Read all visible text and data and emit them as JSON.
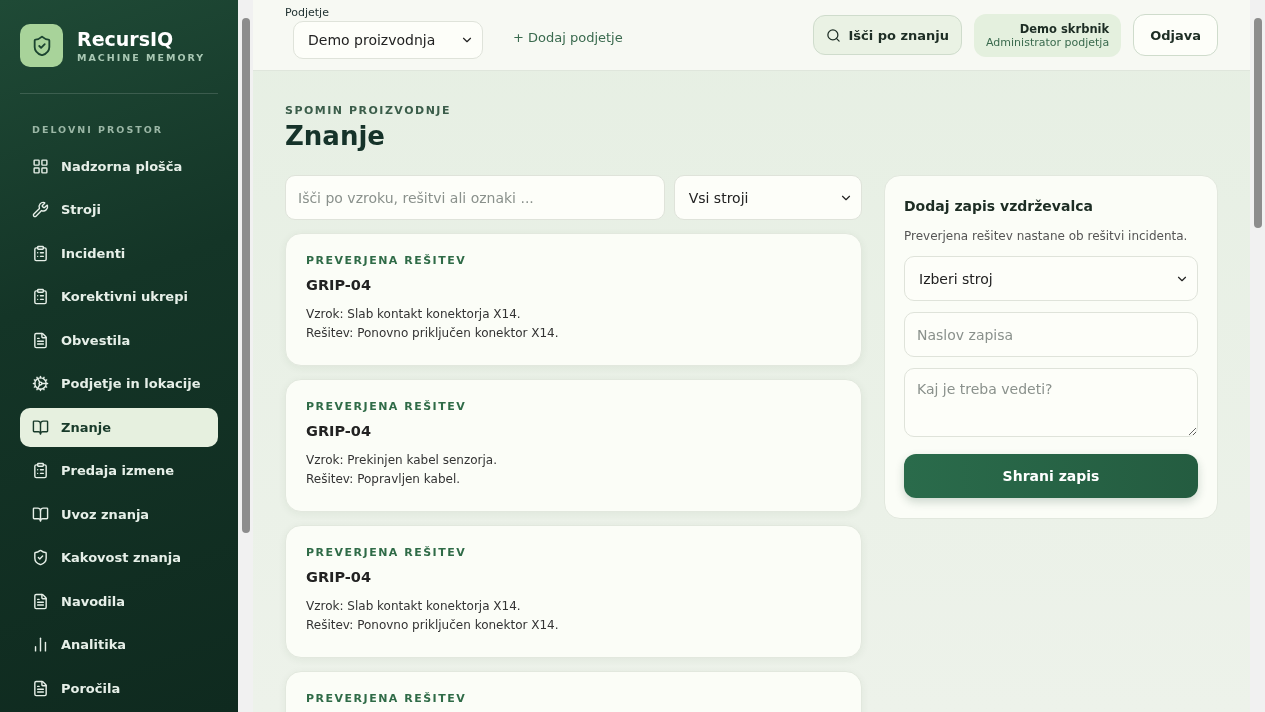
{
  "brand": {
    "name": "RecursIQ",
    "tagline": "MACHINE MEMORY"
  },
  "sidebar": {
    "section": "DELOVNI PROSTOR",
    "items": [
      {
        "label": "Nadzorna plošča",
        "selected": false
      },
      {
        "label": "Stroji",
        "selected": false
      },
      {
        "label": "Incidenti",
        "selected": false
      },
      {
        "label": "Korektivni ukrepi",
        "selected": false
      },
      {
        "label": "Obvestila",
        "selected": false
      },
      {
        "label": "Podjetje in lokacije",
        "selected": false
      },
      {
        "label": "Znanje",
        "selected": true
      },
      {
        "label": "Predaja izmene",
        "selected": false
      },
      {
        "label": "Uvoz znanja",
        "selected": false
      },
      {
        "label": "Kakovost znanja",
        "selected": false
      },
      {
        "label": "Navodila",
        "selected": false
      },
      {
        "label": "Analitika",
        "selected": false
      },
      {
        "label": "Poročila",
        "selected": false
      }
    ]
  },
  "topbar": {
    "company_label": "Podjetje",
    "company_value": "Demo proizvodnja",
    "add_company": "+ Dodaj podjetje",
    "search_button": "Išči po znanju",
    "user_name": "Demo skrbnik",
    "user_role": "Administrator podjetja",
    "logout": "Odjava"
  },
  "page": {
    "eyebrow": "SPOMIN PROIZVODNJE",
    "title": "Znanje"
  },
  "filters": {
    "search_placeholder": "Išči po vzroku, rešitvi ali oznaki ...",
    "machine_value": "Vsi stroji"
  },
  "entries": [
    {
      "tag": "PREVERJENA REŠITEV",
      "title": "GRIP-04",
      "cause": "Vzrok: Slab kontakt konektorja X14.",
      "fix": "Rešitev: Ponovno priključen konektor X14."
    },
    {
      "tag": "PREVERJENA REŠITEV",
      "title": "GRIP-04",
      "cause": "Vzrok: Prekinjen kabel senzorja.",
      "fix": "Rešitev: Popravljen kabel."
    },
    {
      "tag": "PREVERJENA REŠITEV",
      "title": "GRIP-04",
      "cause": "Vzrok: Slab kontakt konektorja X14.",
      "fix": "Rešitev: Ponovno priključen konektor X14."
    },
    {
      "tag": "PREVERJENA REŠITEV"
    }
  ],
  "form": {
    "title": "Dodaj zapis vzdrževalca",
    "hint": "Preverjena rešitev nastane ob rešitvi incidenta.",
    "machine_value": "Izberi stroj",
    "title_placeholder": "Naslov zapisa",
    "body_placeholder": "Kaj je treba vedeti?",
    "submit": "Shrani zapis"
  }
}
